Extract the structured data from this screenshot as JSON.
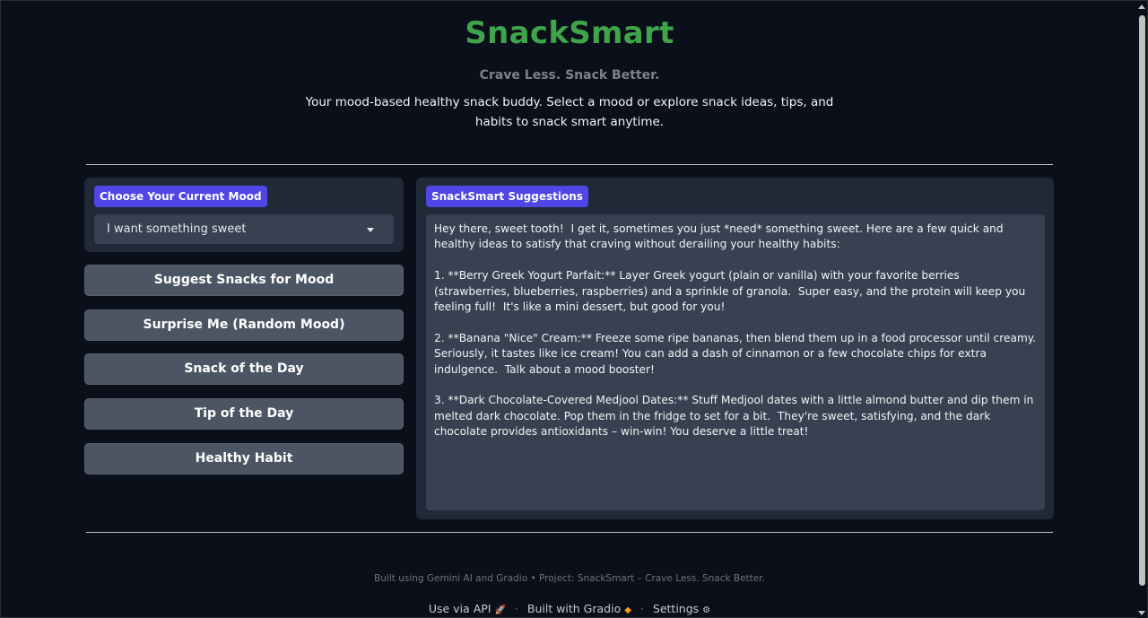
{
  "header": {
    "title": "SnackSmart",
    "tagline": "Crave Less. Snack Better.",
    "description": "Your mood-based healthy snack buddy. Select a mood or explore snack ideas, tips, and habits to snack smart anytime."
  },
  "mood": {
    "label": "Choose Your Current Mood",
    "selected": "I want something sweet"
  },
  "buttons": {
    "suggest": "Suggest Snacks for Mood",
    "surprise": "Surprise Me (Random Mood)",
    "snack_of_day": "Snack of the Day",
    "tip_of_day": "Tip of the Day",
    "healthy_habit": "Healthy Habit"
  },
  "suggestions": {
    "label": "SnackSmart Suggestions",
    "text": "Hey there, sweet tooth!  I get it, sometimes you just *need* something sweet. Here are a few quick and healthy ideas to satisfy that craving without derailing your healthy habits:\n\n1. **Berry Greek Yogurt Parfait:** Layer Greek yogurt (plain or vanilla) with your favorite berries (strawberries, blueberries, raspberries) and a sprinkle of granola.  Super easy, and the protein will keep you feeling full!  It's like a mini dessert, but good for you!\n\n2. **Banana \"Nice\" Cream:** Freeze some ripe bananas, then blend them up in a food processor until creamy.  Seriously, it tastes like ice cream! You can add a dash of cinnamon or a few chocolate chips for extra indulgence.  Talk about a mood booster!\n\n3. **Dark Chocolate-Covered Medjool Dates:** Stuff Medjool dates with a little almond butter and dip them in melted dark chocolate. Pop them in the fridge to set for a bit.  They're sweet, satisfying, and the dark chocolate provides antioxidants – win-win! You deserve a little treat!"
  },
  "footer": {
    "note": "Built using Gemini AI and Gradio • Project: SnackSmart – Crave Less. Snack Better.",
    "api": "Use via API",
    "built_with": "Built with Gradio",
    "settings": "Settings",
    "sep": "·"
  },
  "icons": {
    "api": "rocket-icon",
    "gradio": "gradio-logo-icon",
    "settings": "gear-icon"
  },
  "colors": {
    "title": "#3fa44a",
    "accent": "#4f46e5",
    "background": "#0b0f19"
  }
}
